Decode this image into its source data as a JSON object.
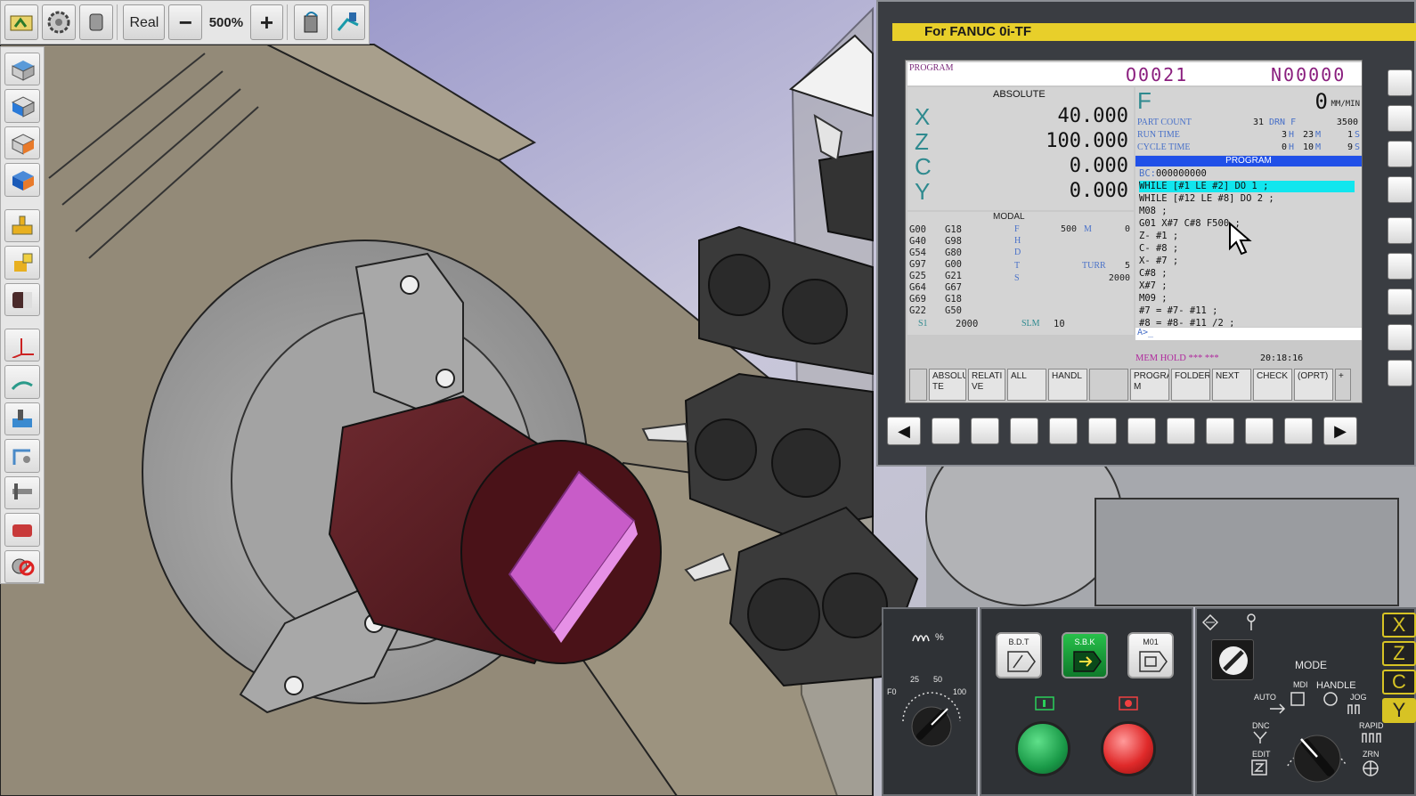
{
  "toolbar": {
    "real_label": "Real",
    "zoom_level": "500%",
    "minus_label": "−",
    "plus_label": "+"
  },
  "cnc": {
    "title": "For FANUC 0i-TF",
    "header": {
      "screen_name": "PROGRAM",
      "o_number": "O0021",
      "n_number": "N00000"
    },
    "absolute": {
      "title": "ABSOLUTE",
      "axes": [
        {
          "name": "X",
          "value": "40.000"
        },
        {
          "name": "Z",
          "value": "100.000"
        },
        {
          "name": "C",
          "value": "0.000"
        },
        {
          "name": "Y",
          "value": "0.000"
        }
      ]
    },
    "modal": {
      "title": "MODAL",
      "codes": [
        "G00",
        "G18",
        "G40",
        "G98",
        "G54",
        "G80",
        "G97",
        "G00",
        "G25",
        "G21",
        "G64",
        "G67",
        "G69",
        "G18",
        "G22",
        "G50"
      ],
      "f_label": "F",
      "f_value": "500",
      "m_label": "M",
      "m_value": "0",
      "h_label": "H",
      "d_label": "D",
      "t_label": "T",
      "turr_label": "TURR",
      "turr_value": "5",
      "s_label": "S",
      "s_value": "2000",
      "s1_label": "S1",
      "s1_value": "2000",
      "slm_label": "SLM",
      "slm_value": "10"
    },
    "rate": {
      "f_label": "F",
      "f_value": "0",
      "f_unit": "MM/MIN",
      "part_count_label": "PART COUNT",
      "part_count_value": "31",
      "drn_label": "DRN F",
      "drn_value": "3500",
      "run_time_label": "RUN TIME",
      "run_h": "3",
      "run_m": "23",
      "run_s": "1",
      "cycle_time_label": "CYCLE TIME",
      "cyc_h": "0",
      "cyc_m": "10",
      "cyc_s": "9",
      "h_unit": "H",
      "m_unit": "M",
      "s_unit": "S"
    },
    "program": {
      "title": "PROGRAM",
      "bc_label": "BC:",
      "bc_value": "000000000",
      "lines": [
        "WHILE [#1 LE #2] DO 1 ;",
        "WHILE [#12 LE #8] DO 2 ;",
        "M08 ;",
        "G01 X#7 C#8 F500 ;",
        "Z- #1 ;",
        "C- #8 ;",
        "X- #7 ;",
        "C#8 ;",
        "X#7 ;",
        "M09 ;",
        "#7 = #7- #11 ;",
        "#8 = #8- #11 /2 ;"
      ],
      "input_prompt": "A>_"
    },
    "status": {
      "mode": "MEM HOLD *** ***",
      "time": "20:18:16"
    },
    "softkeys": [
      "ABSOLU\nTE",
      "RELATI\nVE",
      "ALL",
      "HANDL",
      "",
      "PROGRA\nM",
      "FOLDER",
      "NEXT",
      "CHECK",
      "(OPRT)",
      "+"
    ]
  },
  "operator": {
    "feed_label": "%",
    "feed_ticks": [
      "F0",
      "25",
      "50",
      "100"
    ],
    "bdt_label": "B.D.T",
    "sbk_label": "S.B.K",
    "m01_label": "M01",
    "mode_label": "MODE",
    "mode_items": [
      "MDI",
      "HANDLE",
      "AUTO",
      "JOG",
      "DNC",
      "RAPID",
      "EDIT",
      "ZRN"
    ],
    "axis_keys": [
      "X",
      "Z",
      "C",
      "Y"
    ]
  },
  "colors": {
    "title_bar": "#e8cf2a",
    "program_header": "#2050e8",
    "highlight_line": "#11e6ee",
    "workpiece": "#5a1a1f",
    "workpiece_face": "#c85cc8",
    "cycle_start": "#1a9a48",
    "feed_hold": "#e02a2a"
  }
}
